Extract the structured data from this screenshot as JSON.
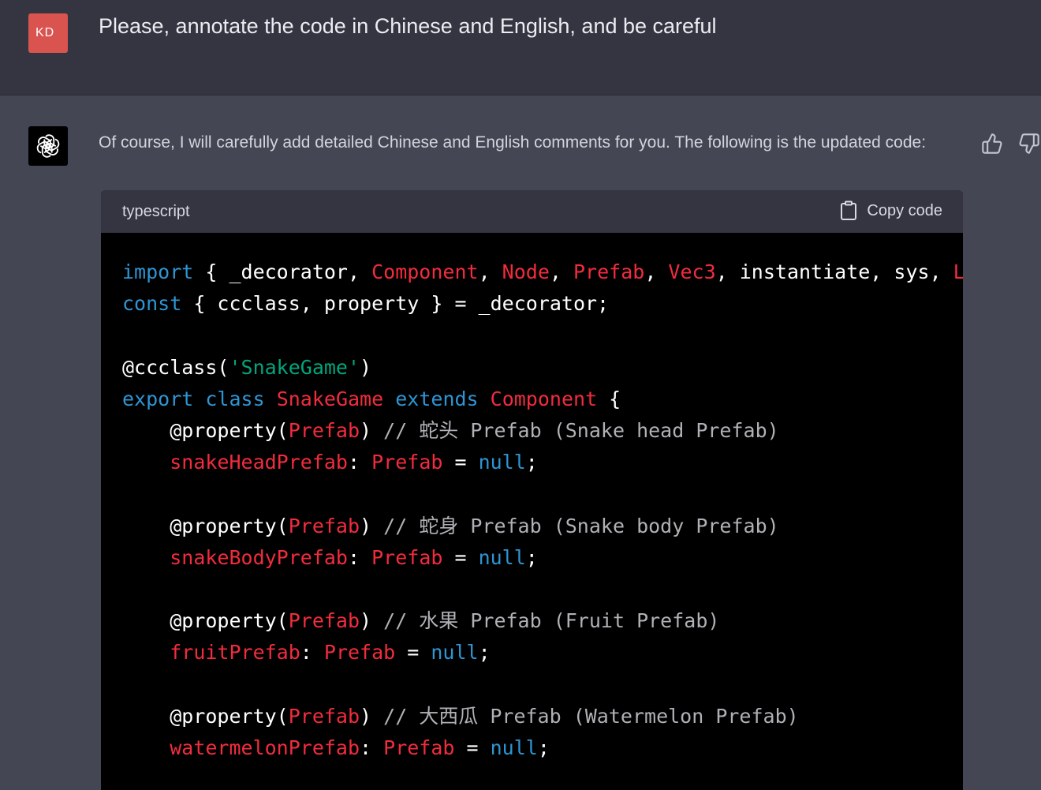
{
  "user": {
    "avatar_initials": "KD",
    "message": "Please, annotate the code in Chinese and English, and be careful"
  },
  "assistant": {
    "message": "Of course, I will carefully add detailed Chinese and English comments for you. The following is the updated code:",
    "feedback": {
      "thumbs_up_icon": "thumbs-up-icon",
      "thumbs_down_icon": "thumbs-down-icon"
    }
  },
  "code_block": {
    "language": "typescript",
    "copy_label": "Copy code",
    "lines": [
      [
        {
          "t": "import",
          "c": "kw"
        },
        {
          "t": " { _decorator, ",
          "c": ""
        },
        {
          "t": "Component",
          "c": "ty"
        },
        {
          "t": ", ",
          "c": ""
        },
        {
          "t": "Node",
          "c": "ty"
        },
        {
          "t": ", ",
          "c": ""
        },
        {
          "t": "Prefab",
          "c": "ty"
        },
        {
          "t": ", ",
          "c": ""
        },
        {
          "t": "Vec3",
          "c": "ty"
        },
        {
          "t": ", instantiate, sys, ",
          "c": ""
        },
        {
          "t": "Label",
          "c": "ty"
        }
      ],
      [
        {
          "t": "const",
          "c": "kw"
        },
        {
          "t": " { ccclass, property } = _decorator;",
          "c": ""
        }
      ],
      [],
      [
        {
          "t": "@ccclass(",
          "c": ""
        },
        {
          "t": "'SnakeGame'",
          "c": "str"
        },
        {
          "t": ")",
          "c": ""
        }
      ],
      [
        {
          "t": "export",
          "c": "kw"
        },
        {
          "t": " ",
          "c": ""
        },
        {
          "t": "class",
          "c": "kw"
        },
        {
          "t": " ",
          "c": ""
        },
        {
          "t": "SnakeGame",
          "c": "ty"
        },
        {
          "t": " ",
          "c": ""
        },
        {
          "t": "extends",
          "c": "kw"
        },
        {
          "t": " ",
          "c": ""
        },
        {
          "t": "Component",
          "c": "ty"
        },
        {
          "t": " {",
          "c": ""
        }
      ],
      [
        {
          "t": "    @property(",
          "c": ""
        },
        {
          "t": "Prefab",
          "c": "ty"
        },
        {
          "t": ") ",
          "c": ""
        },
        {
          "t": "// 蛇头 Prefab (Snake head Prefab)",
          "c": "cm"
        }
      ],
      [
        {
          "t": "    ",
          "c": ""
        },
        {
          "t": "snakeHeadPrefab",
          "c": "ty"
        },
        {
          "t": ": ",
          "c": ""
        },
        {
          "t": "Prefab",
          "c": "ty"
        },
        {
          "t": " = ",
          "c": ""
        },
        {
          "t": "null",
          "c": "kw"
        },
        {
          "t": ";",
          "c": ""
        }
      ],
      [],
      [
        {
          "t": "    @property(",
          "c": ""
        },
        {
          "t": "Prefab",
          "c": "ty"
        },
        {
          "t": ") ",
          "c": ""
        },
        {
          "t": "// 蛇身 Prefab (Snake body Prefab)",
          "c": "cm"
        }
      ],
      [
        {
          "t": "    ",
          "c": ""
        },
        {
          "t": "snakeBodyPrefab",
          "c": "ty"
        },
        {
          "t": ": ",
          "c": ""
        },
        {
          "t": "Prefab",
          "c": "ty"
        },
        {
          "t": " = ",
          "c": ""
        },
        {
          "t": "null",
          "c": "kw"
        },
        {
          "t": ";",
          "c": ""
        }
      ],
      [],
      [
        {
          "t": "    @property(",
          "c": ""
        },
        {
          "t": "Prefab",
          "c": "ty"
        },
        {
          "t": ") ",
          "c": ""
        },
        {
          "t": "// 水果 Prefab (Fruit Prefab)",
          "c": "cm"
        }
      ],
      [
        {
          "t": "    ",
          "c": ""
        },
        {
          "t": "fruitPrefab",
          "c": "ty"
        },
        {
          "t": ": ",
          "c": ""
        },
        {
          "t": "Prefab",
          "c": "ty"
        },
        {
          "t": " = ",
          "c": ""
        },
        {
          "t": "null",
          "c": "kw"
        },
        {
          "t": ";",
          "c": ""
        }
      ],
      [],
      [
        {
          "t": "    @property(",
          "c": ""
        },
        {
          "t": "Prefab",
          "c": "ty"
        },
        {
          "t": ") ",
          "c": ""
        },
        {
          "t": "// 大西瓜 Prefab (Watermelon Prefab)",
          "c": "cm"
        }
      ],
      [
        {
          "t": "    ",
          "c": ""
        },
        {
          "t": "watermelonPrefab",
          "c": "ty"
        },
        {
          "t": ": ",
          "c": ""
        },
        {
          "t": "Prefab",
          "c": "ty"
        },
        {
          "t": " = ",
          "c": ""
        },
        {
          "t": "null",
          "c": "kw"
        },
        {
          "t": ";",
          "c": ""
        }
      ]
    ]
  },
  "colors": {
    "page_bg": "#444654",
    "user_bg": "#343541",
    "user_avatar": "#d9534f",
    "code_bg": "#000000",
    "keyword": "#2e95d3",
    "type": "#f22c3d",
    "string": "#00a67d",
    "comment": "#b0b0b6"
  }
}
